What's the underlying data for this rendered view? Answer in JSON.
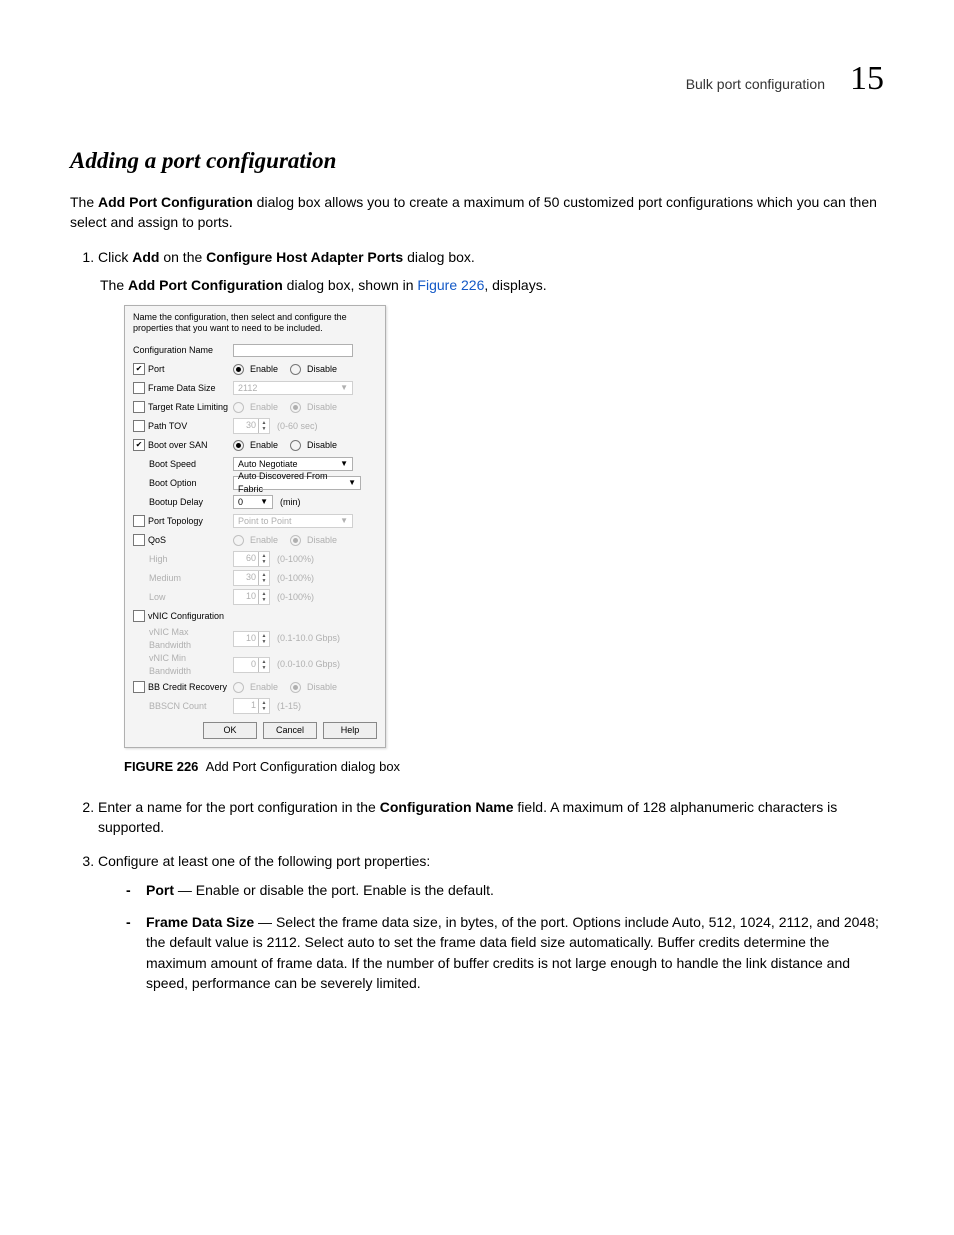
{
  "header": {
    "crumb": "Bulk port configuration",
    "chapnum": "15"
  },
  "title": "Adding a port configuration",
  "intro": {
    "pre": "The ",
    "bold": "Add Port Configuration",
    "post": " dialog box allows you to create a maximum of 50 customized port configurations which you can then select and assign to ports."
  },
  "step1": {
    "pre": "Click ",
    "b1": "Add",
    "mid": " on the ",
    "b2": "Configure Host Adapter Ports",
    "post": " dialog box."
  },
  "step1sub": {
    "pre": "The ",
    "b": "Add Port Configuration",
    "mid": " dialog box, shown in ",
    "link": "Figure 226",
    "post": ", displays."
  },
  "figcap": {
    "num": "FIGURE 226",
    "text": "Add Port Configuration dialog box"
  },
  "step2": {
    "pre": "Enter a name for the port configuration in the ",
    "b": "Configuration Name",
    "post": " field. A maximum of 128 alphanumeric characters is supported."
  },
  "step3": {
    "text": "Configure at least one of the following port properties:"
  },
  "b_port": {
    "name": "Port",
    "desc": " — Enable or disable the port. Enable is the default."
  },
  "b_fds": {
    "name": "Frame Data Size",
    "desc": " — Select the frame data size, in bytes, of the port. Options include Auto, 512, 1024, 2112, and 2048; the default value is 2112. Select auto to set the frame data field size automatically.  Buffer credits determine the maximum amount of frame data. If the number of buffer credits is not large enough to handle the link distance and speed, performance can be severely limited."
  },
  "dlg": {
    "hint": "Name the configuration, then select and configure the properties that you want to need to be included.",
    "lbl": {
      "cfgname": "Configuration Name",
      "port": "Port",
      "fds": "Frame Data Size",
      "trl": "Target Rate Limiting",
      "tov": "Path TOV",
      "bos": "Boot over SAN",
      "bspeed": "Boot Speed",
      "bopt": "Boot Option",
      "bdelay": "Bootup Delay",
      "ptop": "Port Topology",
      "qos": "QoS",
      "high": "High",
      "medium": "Medium",
      "low": "Low",
      "vnic": "vNIC Configuration",
      "vmax": "vNIC Max Bandwidth",
      "vmin": "vNIC Min Bandwidth",
      "bb": "BB Credit Recovery",
      "bbcnt": "BBSCN Count"
    },
    "radio": {
      "enable": "Enable",
      "disable": "Disable"
    },
    "val": {
      "fds": "2112",
      "tov": "30",
      "tov_u": "(0-60 sec)",
      "bspeed": "Auto Negotiate",
      "bopt": "Auto Discovered From Fabric",
      "bdelay": "0",
      "bdelay_u": "(min)",
      "ptop": "Point to Point",
      "high": "60",
      "medium": "30",
      "low": "10",
      "qos_u": "(0-100%)",
      "vmax": "10",
      "vmax_u": "(0.1-10.0 Gbps)",
      "vmin": "0",
      "vmin_u": "(0.0-10.0 Gbps)",
      "bbcnt": "1",
      "bbcnt_u": "(1-15)"
    },
    "btn": {
      "ok": "OK",
      "cancel": "Cancel",
      "help": "Help"
    }
  }
}
